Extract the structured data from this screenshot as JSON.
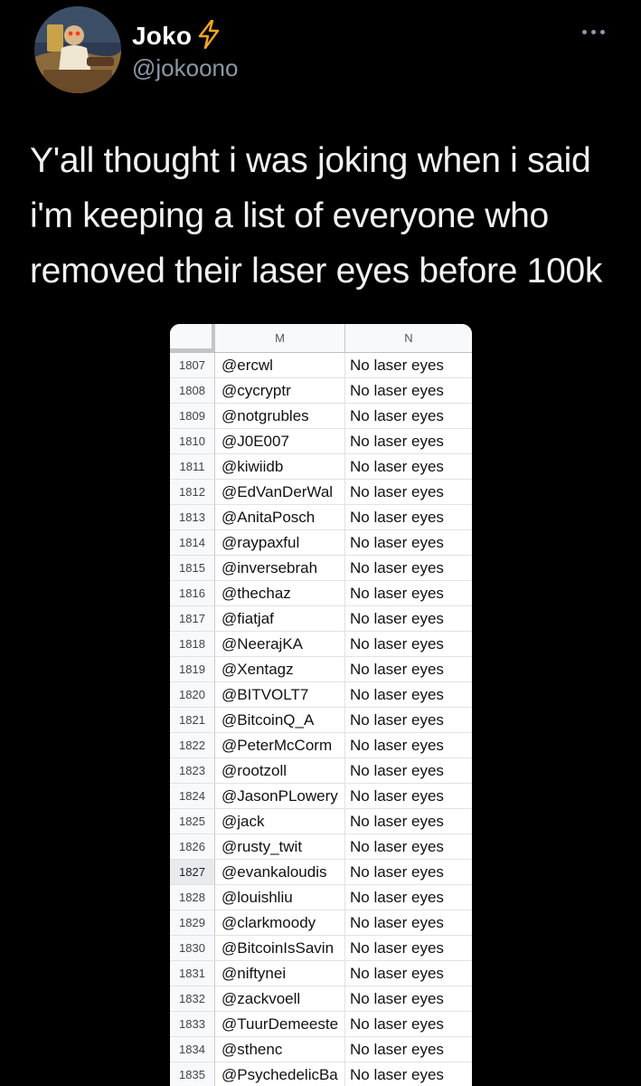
{
  "tweet": {
    "display_name": "Joko",
    "handle": "@jokoono",
    "text": "Y'all thought i was joking when i said i'm keeping a list of everyone who removed their laser eyes before 100k",
    "name_badge_icon": "lightning-bolt-icon",
    "menu_icon": "more-options-icon"
  },
  "sheet": {
    "columns": [
      "M",
      "N"
    ],
    "selected_row": "1827",
    "rows": [
      {
        "num": "1807",
        "m": "@ercwl",
        "n": "No laser eyes"
      },
      {
        "num": "1808",
        "m": "@cycryptr",
        "n": "No laser eyes"
      },
      {
        "num": "1809",
        "m": "@notgrubles",
        "n": "No laser eyes"
      },
      {
        "num": "1810",
        "m": "@J0E007",
        "n": "No laser eyes"
      },
      {
        "num": "1811",
        "m": "@kiwiidb",
        "n": "No laser eyes"
      },
      {
        "num": "1812",
        "m": "@EdVanDerWal",
        "n": "No laser eyes"
      },
      {
        "num": "1813",
        "m": "@AnitaPosch",
        "n": "No laser eyes"
      },
      {
        "num": "1814",
        "m": "@raypaxful",
        "n": "No laser eyes"
      },
      {
        "num": "1815",
        "m": "@inversebrah",
        "n": "No laser eyes"
      },
      {
        "num": "1816",
        "m": "@thechaz",
        "n": "No laser eyes"
      },
      {
        "num": "1817",
        "m": "@fiatjaf",
        "n": "No laser eyes"
      },
      {
        "num": "1818",
        "m": "@NeerajKA",
        "n": "No laser eyes"
      },
      {
        "num": "1819",
        "m": "@Xentagz",
        "n": "No laser eyes"
      },
      {
        "num": "1820",
        "m": "@BITVOLT7",
        "n": "No laser eyes"
      },
      {
        "num": "1821",
        "m": "@BitcoinQ_A",
        "n": "No laser eyes"
      },
      {
        "num": "1822",
        "m": "@PeterMcCorm",
        "n": "No laser eyes"
      },
      {
        "num": "1823",
        "m": "@rootzoll",
        "n": "No laser eyes"
      },
      {
        "num": "1824",
        "m": "@JasonPLowery",
        "n": "No laser eyes"
      },
      {
        "num": "1825",
        "m": "@jack",
        "n": "No laser eyes"
      },
      {
        "num": "1826",
        "m": "@rusty_twit",
        "n": "No laser eyes"
      },
      {
        "num": "1827",
        "m": "@evankaloudis",
        "n": "No laser eyes"
      },
      {
        "num": "1828",
        "m": "@louishliu",
        "n": "No laser eyes"
      },
      {
        "num": "1829",
        "m": "@clarkmoody",
        "n": "No laser eyes"
      },
      {
        "num": "1830",
        "m": "@BitcoinIsSavin",
        "n": "No laser eyes"
      },
      {
        "num": "1831",
        "m": "@niftynei",
        "n": "No laser eyes"
      },
      {
        "num": "1832",
        "m": "@zackvoell",
        "n": "No laser eyes"
      },
      {
        "num": "1833",
        "m": "@TuurDemeeste",
        "n": "No laser eyes"
      },
      {
        "num": "1834",
        "m": "@sthenc",
        "n": "No laser eyes"
      },
      {
        "num": "1835",
        "m": "@PsychedelicBa",
        "n": "No laser eyes"
      }
    ]
  }
}
